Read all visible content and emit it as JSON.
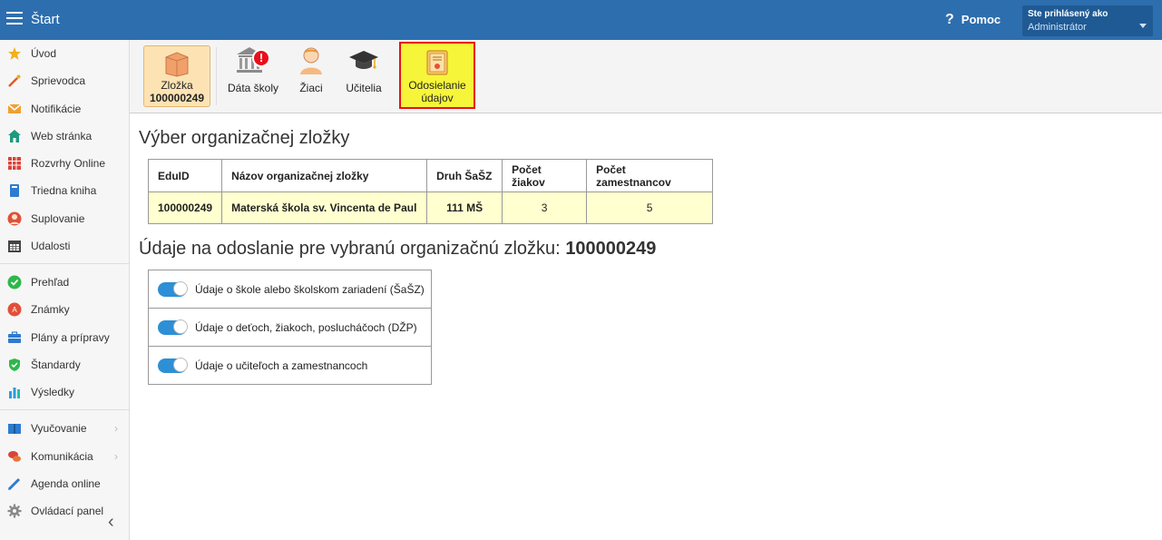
{
  "header": {
    "title": "Štart",
    "help_label": "Pomoc",
    "user_line1": "Ste prihlásený ako",
    "user_line2": "Administrátor"
  },
  "sidebar": {
    "items": [
      {
        "label": "Úvod",
        "icon": "star-icon",
        "color": "#f2b01e"
      },
      {
        "label": "Sprievodca",
        "icon": "wand-icon",
        "color": "#e05a2b"
      },
      {
        "label": "Notifikácie",
        "icon": "envelope-icon",
        "color": "#f0a030"
      },
      {
        "label": "Web stránka",
        "icon": "house-icon",
        "color": "#1e9a7c"
      },
      {
        "label": "Rozvrhy Online",
        "icon": "grid-calendar-icon",
        "color": "#d9443a"
      },
      {
        "label": "Triedna kniha",
        "icon": "book-icon",
        "color": "#2d7bd1"
      },
      {
        "label": "Suplovanie",
        "icon": "person-icon",
        "color": "#e0503a"
      },
      {
        "label": "Udalosti",
        "icon": "calendar-icon",
        "color": "#444444"
      },
      {
        "label": "Prehľad",
        "icon": "check-circle-icon",
        "color": "#2eb84b"
      },
      {
        "label": "Známky",
        "icon": "grade-icon",
        "color": "#e0503a"
      },
      {
        "label": "Plány a prípravy",
        "icon": "briefcase-icon",
        "color": "#2d7bd1"
      },
      {
        "label": "Štandardy",
        "icon": "shield-check-icon",
        "color": "#2eb84b"
      },
      {
        "label": "Výsledky",
        "icon": "bar-chart-icon",
        "color": "#2d9be0"
      },
      {
        "label": "Vyučovanie",
        "icon": "open-book-icon",
        "color": "#2d7bd1",
        "arrow": "›"
      },
      {
        "label": "Komunikácia",
        "icon": "chat-icon",
        "color": "#d9443a",
        "arrow": "›"
      },
      {
        "label": "Agenda online",
        "icon": "pencil-icon",
        "color": "#2d7bd1"
      },
      {
        "label": "Ovládací panel",
        "icon": "gear-icon",
        "color": "#888888"
      }
    ],
    "collapse_glyph": "‹"
  },
  "toolbar": {
    "folder_label": "Zložka",
    "folder_id": "100000249",
    "school_data_label": "Dáta školy",
    "students_label": "Žiaci",
    "teachers_label": "Učitelia",
    "send_label_1": "Odosielanie",
    "send_label_2": "údajov",
    "alert_glyph": "!"
  },
  "main": {
    "title": "Výber organizačnej zložky",
    "table": {
      "headers": [
        "EduID",
        "Názov organizačnej zložky",
        "Druh ŠaŠZ",
        "Počet žiakov",
        "Počet zamestnancov"
      ],
      "row": [
        "100000249",
        "Materská škola sv. Vincenta de Paul",
        "111 MŠ",
        "3",
        "5"
      ]
    },
    "subtitle": "Údaje na odoslanie pre vybranú organizačnú zložku:",
    "subtitle_id": "100000249",
    "toggles": [
      {
        "label": "Údaje o škole alebo školskom zariadení (ŠaŠZ)",
        "on": true
      },
      {
        "label": "Údaje o deťoch, žiakoch, poslucháčoch (DŽP)",
        "on": true
      },
      {
        "label": "Údaje o učiteľoch a zamestnancoch",
        "on": true
      }
    ]
  }
}
